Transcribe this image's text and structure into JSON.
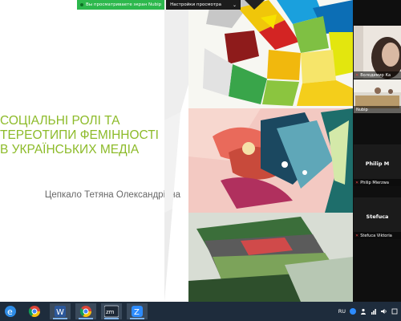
{
  "share_bar": {
    "status_text": "Вы просматриваете экран Nubip",
    "view_options_label": "Настройки просмотра"
  },
  "slide": {
    "title": "СОЦІАЛЬНІ РОЛІ ТА\nТЕРЕОТИПИ ФЕМІННОСТІ\nВ УКРАЇНСЬКИХ МЕДІА",
    "author": "Цепкало Тетяна Олександрівна"
  },
  "participants": [
    {
      "name": "Володимир Ка",
      "has_video": true
    },
    {
      "name": "Nubip",
      "has_video": true
    },
    {
      "name": "Philip Mierzwa",
      "display_name": "Philip M",
      "has_video": false
    },
    {
      "name": "Stefuca Viktoria",
      "display_name": "Stefuca",
      "has_video": false
    }
  ],
  "taskbar": {
    "apps": [
      "edge-icon",
      "chrome-icon",
      "word-icon",
      "chrome-icon",
      "zm-icon",
      "zoom-icon"
    ],
    "zm_label": "zm",
    "zoom_label": "Z",
    "word_label": "W",
    "language": "RU"
  },
  "colors": {
    "title_green": "#8dbb2a",
    "share_green": "#2db84d",
    "taskbar": "#1e2c3c"
  }
}
